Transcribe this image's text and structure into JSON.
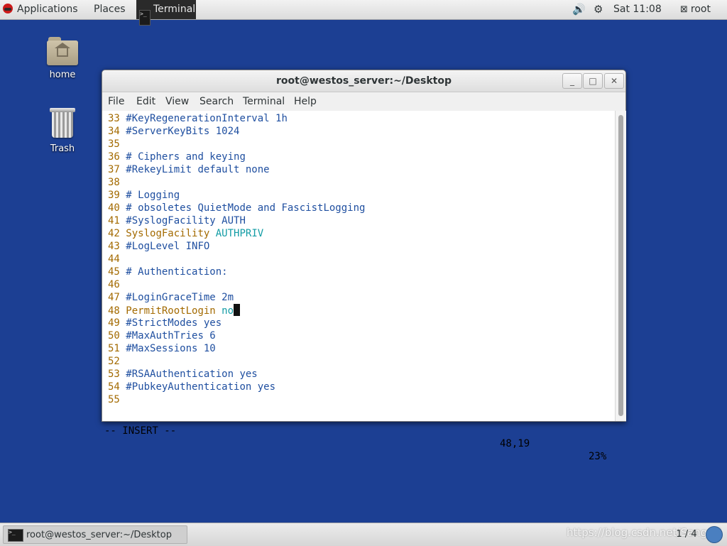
{
  "topbar": {
    "applications": "Applications",
    "places": "Places",
    "active_app": "Terminal",
    "clock": "Sat 11:08",
    "user": "root"
  },
  "desktop": {
    "icons": [
      {
        "label": "home",
        "icon": "home-folder-icon"
      },
      {
        "label": "Trash",
        "icon": "trash-icon"
      }
    ]
  },
  "window": {
    "title": "root@westos_server:~/Desktop",
    "controls": {
      "minimize": "_",
      "maximize": "□",
      "close": "✕"
    },
    "menu": [
      "File",
      "Edit",
      "View",
      "Search",
      "Terminal",
      "Help"
    ]
  },
  "editor": {
    "lines": [
      {
        "num": "33",
        "text": "#KeyRegenerationInterval 1h"
      },
      {
        "num": "34",
        "text": "#ServerKeyBits 1024"
      },
      {
        "num": "35",
        "text": ""
      },
      {
        "num": "36",
        "text": "# Ciphers and keying"
      },
      {
        "num": "37",
        "text": "#RekeyLimit default none"
      },
      {
        "num": "38",
        "text": ""
      },
      {
        "num": "39",
        "text": "# Logging"
      },
      {
        "num": "40",
        "text": "# obsoletes QuietMode and FascistLogging"
      },
      {
        "num": "41",
        "text": "#SyslogFacility AUTH"
      },
      {
        "num": "42",
        "key": "SyslogFacility",
        "value": "AUTHPRIV"
      },
      {
        "num": "43",
        "text": "#LogLevel INFO"
      },
      {
        "num": "44",
        "text": ""
      },
      {
        "num": "45",
        "text": "# Authentication:"
      },
      {
        "num": "46",
        "text": ""
      },
      {
        "num": "47",
        "text": "#LoginGraceTime 2m"
      },
      {
        "num": "48",
        "key": "PermitRootLogin",
        "value": "no"
      },
      {
        "num": "49",
        "text": "#StrictModes yes"
      },
      {
        "num": "50",
        "text": "#MaxAuthTries 6"
      },
      {
        "num": "51",
        "text": "#MaxSessions 10"
      },
      {
        "num": "52",
        "text": ""
      },
      {
        "num": "53",
        "text": "#RSAAuthentication yes"
      },
      {
        "num": "54",
        "text": "#PubkeyAuthentication yes"
      },
      {
        "num": "55",
        "text": ""
      }
    ],
    "status": {
      "mode": "-- INSERT --",
      "position": "48,19",
      "percent": "23%"
    }
  },
  "taskbar": {
    "task_label": "root@westos_server:~/Desktop",
    "workspace": "1 / 4",
    "watermark": "https://blog.csdn.net/Sangerl"
  }
}
